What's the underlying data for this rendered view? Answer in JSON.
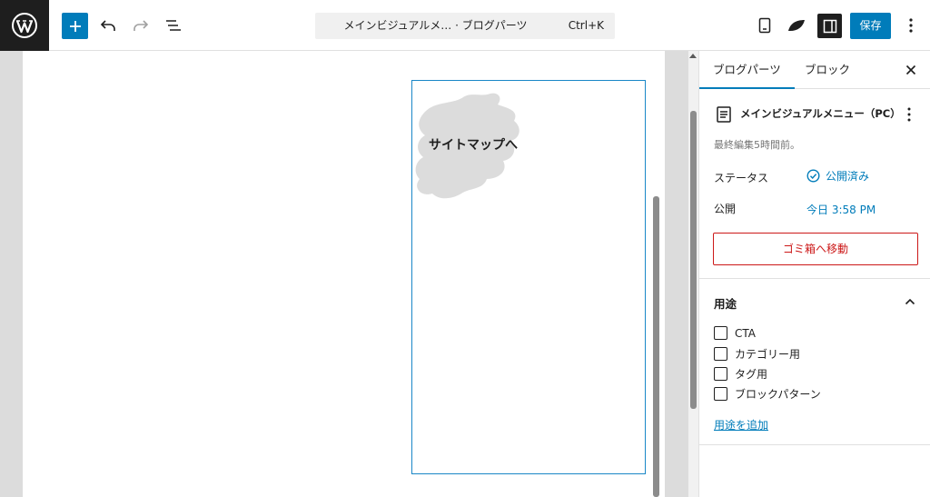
{
  "toolbar": {
    "document_title": "メインビジュアルメ… · ブログパーツ",
    "shortcut": "Ctrl+K",
    "save_label": "保存"
  },
  "canvas": {
    "block_text": "サイトマップへ"
  },
  "sidebar": {
    "tabs": [
      {
        "label": "ブログパーツ",
        "active": true
      },
      {
        "label": "ブロック",
        "active": false
      }
    ],
    "post": {
      "title": "メインビジュアルメニュー（PC）",
      "last_edited": "最終編集5時間前。",
      "status_label": "ステータス",
      "status_value": "公開済み",
      "publish_label": "公開",
      "publish_value": "今日 3:58 PM",
      "trash_label": "ゴミ箱へ移動"
    },
    "usage": {
      "heading": "用途",
      "options": [
        {
          "label": "CTA",
          "checked": false
        },
        {
          "label": "カテゴリー用",
          "checked": false
        },
        {
          "label": "タグ用",
          "checked": false
        },
        {
          "label": "ブロックパターン",
          "checked": false
        }
      ],
      "add_link": "用途を追加"
    }
  },
  "colors": {
    "accent": "#007cba",
    "danger": "#cc1818",
    "dark": "#1e1e1e"
  }
}
